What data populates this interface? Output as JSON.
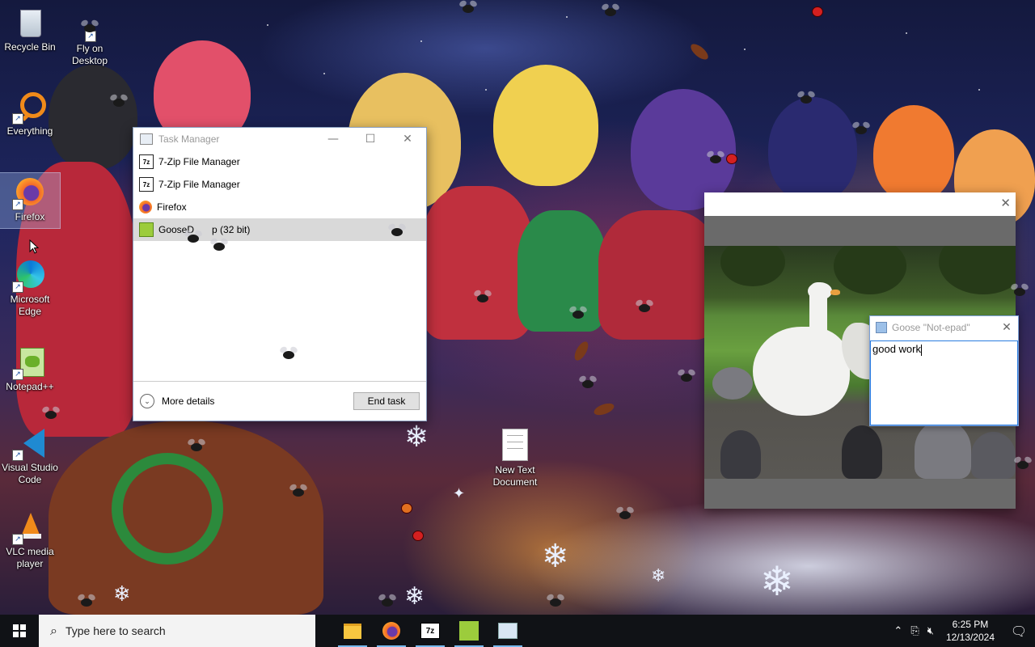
{
  "desktop": {
    "icons": [
      {
        "label": "Recycle Bin",
        "icon": "recycle-bin-icon"
      },
      {
        "label": "Fly on Desktop",
        "icon": "fly-icon"
      },
      {
        "label": "Everything",
        "icon": "everything-search-icon"
      },
      {
        "label": "Firefox",
        "icon": "firefox-icon"
      },
      {
        "label": "Microsoft Edge",
        "icon": "edge-icon"
      },
      {
        "label": "Notepad++",
        "icon": "notepadplusplus-icon"
      },
      {
        "label": "Visual Studio Code",
        "icon": "vscode-icon"
      },
      {
        "label": "VLC media player",
        "icon": "vlc-icon"
      },
      {
        "label": "New Text Document",
        "icon": "text-document-icon"
      }
    ]
  },
  "task_manager": {
    "title": "Task Manager",
    "apps": [
      {
        "name": "7-Zip File Manager",
        "icon": "7zip-icon"
      },
      {
        "name": "7-Zip File Manager",
        "icon": "7zip-icon"
      },
      {
        "name": "Firefox",
        "icon": "firefox-icon"
      },
      {
        "name": "GooseDesktop (32 bit)",
        "icon": "goose-desktop-icon",
        "visible_text_start": "GooseD",
        "visible_text_end": "p (32 bit)"
      }
    ],
    "selected_index": 3,
    "more_details_label": "More details",
    "end_task_label": "End task"
  },
  "video_window": {
    "content": "goose walking among pigeons video frame"
  },
  "notepad": {
    "title": "Goose \"Not-epad\"",
    "text": "good work"
  },
  "taskbar": {
    "search_placeholder": "Type here to search",
    "pinned": [
      {
        "name": "File Explorer",
        "icon": "folder-icon",
        "active": true
      },
      {
        "name": "Firefox",
        "icon": "firefox-icon",
        "active": true
      },
      {
        "name": "7-Zip File Manager",
        "icon": "7zip-icon",
        "active": true
      },
      {
        "name": "GooseDesktop",
        "icon": "goose-desktop-icon",
        "active": true
      },
      {
        "name": "Goose Not-epad",
        "icon": "notepad-icon",
        "active": true
      }
    ],
    "clock_time": "6:25 PM",
    "clock_date": "12/13/2024"
  },
  "colors": {
    "taskbar_bg": "#101216",
    "accent": "#76b9ed",
    "selected_row": "#d9d9d9"
  }
}
